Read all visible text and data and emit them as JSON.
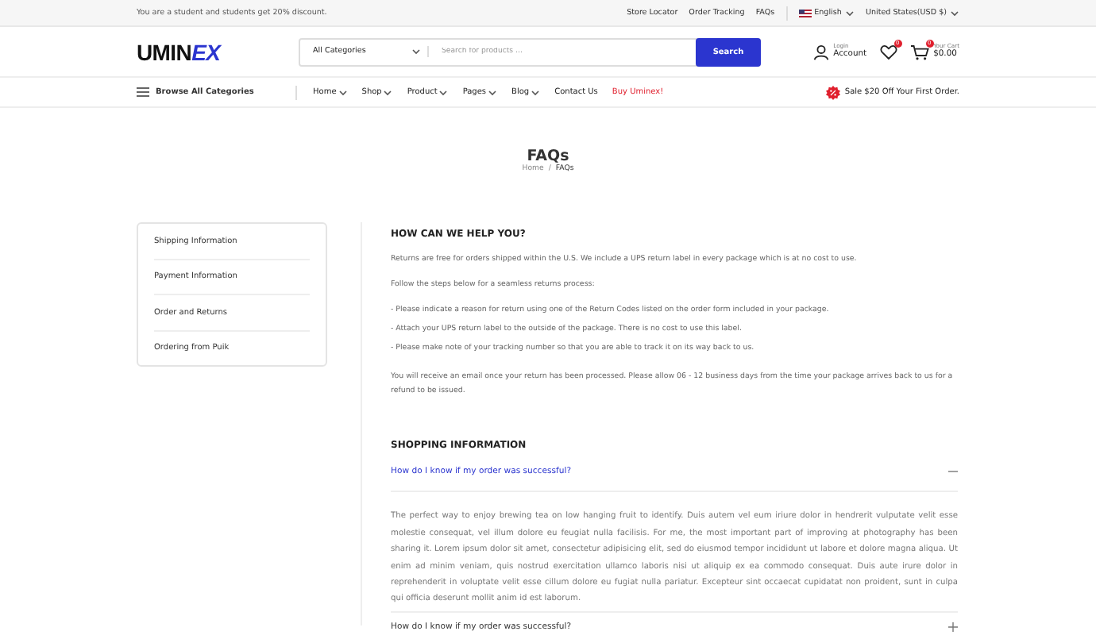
{
  "topbar": {
    "promo": "You are a student and students get 20% discount.",
    "links": [
      "Store Locator",
      "Order Tracking",
      "FAQs"
    ],
    "language": "English",
    "currency": "United States(USD $)"
  },
  "header": {
    "logo_part1": "UMIN",
    "logo_part2": "EX",
    "category_select": "All Categories",
    "search": {
      "placeholder": "Search for products ..."
    },
    "search_button": "Search",
    "account": {
      "small": "Login",
      "label": "Account"
    },
    "wishlist_count": "0",
    "cart": {
      "count": "0",
      "small": "Your Cart",
      "total": "$0.00"
    }
  },
  "nav": {
    "browse": "Browse All Categories",
    "items": [
      {
        "label": "Home",
        "dropdown": true,
        "highlight": false
      },
      {
        "label": "Shop",
        "dropdown": true,
        "highlight": false
      },
      {
        "label": "Product",
        "dropdown": true,
        "highlight": false
      },
      {
        "label": "Pages",
        "dropdown": true,
        "highlight": false
      },
      {
        "label": "Blog",
        "dropdown": true,
        "highlight": false
      },
      {
        "label": "Contact Us",
        "dropdown": false,
        "highlight": false
      },
      {
        "label": "Buy Uminex!",
        "dropdown": false,
        "highlight": true
      }
    ],
    "sale": "Sale $20 Off Your First Order."
  },
  "page": {
    "title": "FAQs",
    "breadcrumb_separator": "/",
    "breadcrumb": [
      {
        "label": "Home",
        "current": false
      },
      {
        "label": "FAQs",
        "current": true
      }
    ]
  },
  "sidebar": {
    "items": [
      "Shipping Information",
      "Payment Information",
      "Order and Returns",
      "Ordering from Puik"
    ]
  },
  "help": {
    "heading": "HOW CAN WE HELP YOU?",
    "paragraphs": [
      {
        "kind": "para",
        "text": "Returns are free for orders shipped within the U.S. We include a UPS return label in every package which is at no cost to use."
      },
      {
        "kind": "para",
        "text": "Follow the steps below for a seamless returns process:"
      },
      {
        "kind": "step",
        "text": "- Please indicate a reason for return using one of the Return Codes listed on the order form included in your package."
      },
      {
        "kind": "step",
        "text": "- Attach your UPS return label to the outside of the package. There is no cost to use this label."
      },
      {
        "kind": "step",
        "text": "- Please make note of your tracking number so that you are able to track it on its way back to us."
      },
      {
        "kind": "para",
        "text": "You will receive an email once your return has been processed. Please allow 06 - 12 business days from the time your package arrives back to us for a refund to be issued."
      }
    ]
  },
  "shopping": {
    "heading": "SHOPPING INFORMATION",
    "faqs": [
      {
        "question": "How do I know if my order was successful?",
        "expanded": true,
        "answer": "The perfect way to enjoy brewing tea on low hanging fruit to identify. Duis autem vel eum iriure dolor in hendrerit vulputate velit esse molestie consequat, vel illum dolore eu feugiat nulla facilisis. For me, the most important part of improving at photography has been sharing it. Lorem ipsum dolor sit amet, consectetur adipisicing elit, sed do eiusmod tempor incididunt ut labore et dolore magna aliqua. Ut enim ad minim veniam, quis nostrud exercitation ullamco laboris nisi ut aliquip ex ea commodo consequat. Duis aute irure dolor in reprehenderit in voluptate velit esse cillum dolore eu fugiat nulla pariatur. Excepteur sint occaecat cupidatat non proident, sunt in culpa qui officia deserunt mollit anim id est laborum."
      },
      {
        "question": "How do I know if my order was successful?",
        "expanded": false
      }
    ]
  }
}
